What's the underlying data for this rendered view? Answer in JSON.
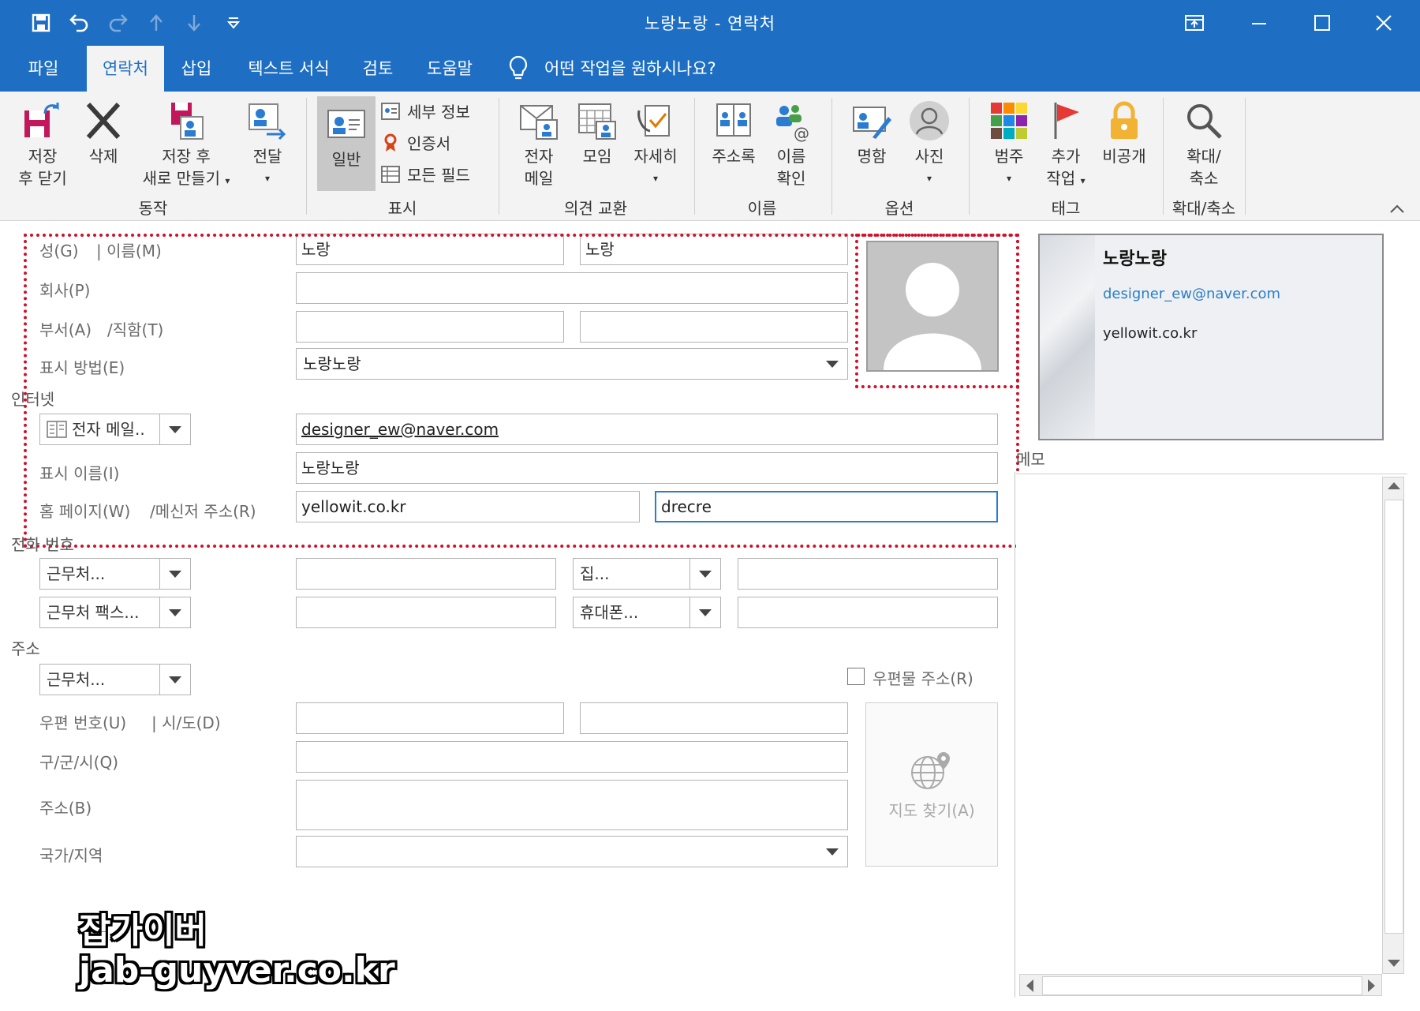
{
  "window": {
    "title": "노랑노랑 - 연락처",
    "qat_icons": [
      "save-icon",
      "undo-icon",
      "redo-icon",
      "up-arrow-icon",
      "down-arrow-icon",
      "customize-icon"
    ],
    "controls": [
      "ribbon-display-icon",
      "minimize-icon",
      "maximize-icon",
      "close-icon"
    ]
  },
  "tabs": [
    {
      "label": "파일"
    },
    {
      "label": "연락처"
    },
    {
      "label": "삽입"
    },
    {
      "label": "텍스트 서식"
    },
    {
      "label": "검토"
    },
    {
      "label": "도움말"
    }
  ],
  "tell_me": "어떤 작업을 원하시나요?",
  "ribbon": {
    "groups": {
      "action": "동작",
      "show": "표시",
      "communicate": "의견 교환",
      "names": "이름",
      "options": "옵션",
      "tags": "태그",
      "zoom": "확대/축소"
    },
    "save_close_1": "저장",
    "save_close_2": "후 닫기",
    "delete": "삭제",
    "save_new_1": "저장 후",
    "save_new_2": "새로 만들기",
    "forward": "전달",
    "general": "일반",
    "details": "세부 정보",
    "certificates": "인증서",
    "all_fields": "모든 필드",
    "email_1": "전자",
    "email_2": "메일",
    "meeting": "모임",
    "more": "자세히",
    "address_book": "주소록",
    "check_names_1": "이름",
    "check_names_2": "확인",
    "business_card": "명함",
    "picture": "사진",
    "categorize": "범주",
    "follow_up_1": "추가",
    "follow_up_2": "작업",
    "private": "비공개",
    "zoom_1": "확대/",
    "zoom_2": "축소"
  },
  "form": {
    "name_label_last": "성(G)",
    "name_label_first": "| 이름(M)",
    "last_name": "노랑",
    "first_name": "노랑",
    "company_label": "회사(P)",
    "company": "",
    "dept_label": "부서(A)",
    "title_label": "/직함(T)",
    "department": "",
    "job_title": "",
    "file_as_label": "표시 방법(E)",
    "file_as": "노랑노랑",
    "internet_section": "인터넷",
    "email_type": "전자 메일..",
    "email": "designer_ew@naver.com",
    "display_name_label": "표시 이름(I)",
    "display_name": "노랑노랑",
    "web_label": "홈 페이지(W)",
    "im_label": "/메신저 주소(R)",
    "web_page": "yellowit.co.kr",
    "im_address": "drecre",
    "phone_section": "전화 번호",
    "phone_type_1": "근무처...",
    "phone_type_2": "근무처 팩스...",
    "phone_type_3": "집...",
    "phone_type_4": "휴대폰...",
    "address_section": "주소",
    "address_type": "근무처...",
    "mailing_label": "우편물 주소(R)",
    "mailing_checked": false,
    "zip_label": "우편 번호(U)",
    "state_label": "| 시/도(D)",
    "city_label": "구/군/시(Q)",
    "street_label": "주소(B)",
    "country_label": "국가/지역",
    "map_button": "지도 찾기(A)"
  },
  "card": {
    "name": "노랑노랑",
    "email": "designer_ew@naver.com",
    "web": "yellowit.co.kr"
  },
  "notes_label": "메모",
  "watermark": {
    "line1": "잡가이버",
    "line2": "jab-guyver.co.kr"
  },
  "colors": {
    "accent": "#1e6fc4",
    "highlight": "#d0102a",
    "link": "#2a7fc9"
  }
}
